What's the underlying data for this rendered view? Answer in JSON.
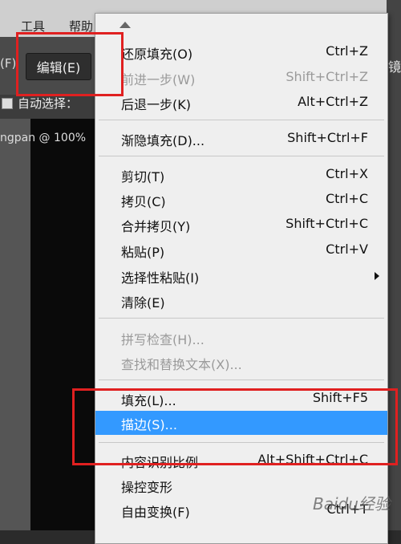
{
  "menubar": {
    "items": [
      "工具",
      "帮助"
    ]
  },
  "options_bar": {
    "left_label": "(F)",
    "edit_button": "编辑(E)",
    "auto_select_label": "自动选择：",
    "right_text": "镜"
  },
  "document_tab": {
    "title": "ngpan @ 100%"
  },
  "edit_menu": {
    "items": [
      {
        "label": "还原填充(O)",
        "shortcut": "Ctrl+Z",
        "disabled": false
      },
      {
        "label": "前进一步(W)",
        "shortcut": "Shift+Ctrl+Z",
        "disabled": true
      },
      {
        "label": "后退一步(K)",
        "shortcut": "Alt+Ctrl+Z",
        "disabled": false
      },
      {
        "label": "渐隐填充(D)...",
        "shortcut": "Shift+Ctrl+F",
        "disabled": false
      },
      {
        "label": "剪切(T)",
        "shortcut": "Ctrl+X",
        "disabled": false
      },
      {
        "label": "拷贝(C)",
        "shortcut": "Ctrl+C",
        "disabled": false
      },
      {
        "label": "合并拷贝(Y)",
        "shortcut": "Shift+Ctrl+C",
        "disabled": false
      },
      {
        "label": "粘贴(P)",
        "shortcut": "Ctrl+V",
        "disabled": false
      },
      {
        "label": "选择性粘贴(I)",
        "shortcut": "",
        "disabled": false,
        "submenu": true
      },
      {
        "label": "清除(E)",
        "shortcut": "",
        "disabled": false
      },
      {
        "label": "拼写检查(H)...",
        "shortcut": "",
        "disabled": true
      },
      {
        "label": "查找和替换文本(X)...",
        "shortcut": "",
        "disabled": true
      },
      {
        "label": "填充(L)...",
        "shortcut": "Shift+F5",
        "disabled": false
      },
      {
        "label": "描边(S)...",
        "shortcut": "",
        "disabled": false,
        "highlighted": true
      },
      {
        "label": "内容识别比例",
        "shortcut": "Alt+Shift+Ctrl+C",
        "disabled": false
      },
      {
        "label": "操控变形",
        "shortcut": "",
        "disabled": false
      },
      {
        "label": "自由变换(F)",
        "shortcut": "Ctrl+T",
        "disabled": false
      }
    ]
  },
  "watermark": "Baidu经验",
  "colors": {
    "highlight": "#3399ff",
    "annotation": "#e02020"
  }
}
